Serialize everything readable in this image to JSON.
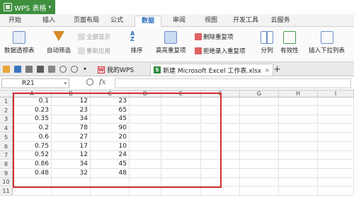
{
  "app": {
    "name": "WPS 表格"
  },
  "ribbon_tabs": [
    "开始",
    "插入",
    "页面布局",
    "公式",
    "数据",
    "审阅",
    "视图",
    "开发工具",
    "云服务"
  ],
  "active_tab": "数据",
  "ribbon": {
    "pivot": "数据透视表",
    "autofilter": "自动筛选",
    "show_all": "全部显示",
    "reapply": "重新应用",
    "sort": "排序",
    "highlight_dup": "高亮重复项",
    "remove_dup": "删除重复项",
    "reject_dup": "拒绝录入重复项",
    "split": "分列",
    "validity": "有效性",
    "dropdown": "插入下拉列表"
  },
  "doc_tabs": {
    "mywps": "我的WPS",
    "file": "新建 Microsoft Excel 工作表.xlsx",
    "add": "+"
  },
  "formula_bar": {
    "cell_ref": "R21",
    "fx": "fx",
    "value": ""
  },
  "sheet": {
    "columns": [
      "A",
      "B",
      "C",
      "D",
      "E",
      "F",
      "G",
      "H",
      "I"
    ],
    "rows": [
      "1",
      "2",
      "3",
      "4",
      "5",
      "6",
      "7",
      "8",
      "9",
      "10",
      "11"
    ],
    "data": [
      [
        "0.1",
        "12",
        "23"
      ],
      [
        "0.23",
        "23",
        "65"
      ],
      [
        "0.35",
        "34",
        "45"
      ],
      [
        "0.2",
        "78",
        "90"
      ],
      [
        "0.6",
        "27",
        "20"
      ],
      [
        "0.75",
        "17",
        "10"
      ],
      [
        "0.52",
        "12",
        "24"
      ],
      [
        "0.86",
        "34",
        "45"
      ],
      [
        "0.48",
        "32",
        "48"
      ]
    ]
  },
  "colors": {
    "app_green": "#3e8f3e",
    "accent_blue": "#2a6fbf",
    "selection_red": "#d32f2f"
  }
}
